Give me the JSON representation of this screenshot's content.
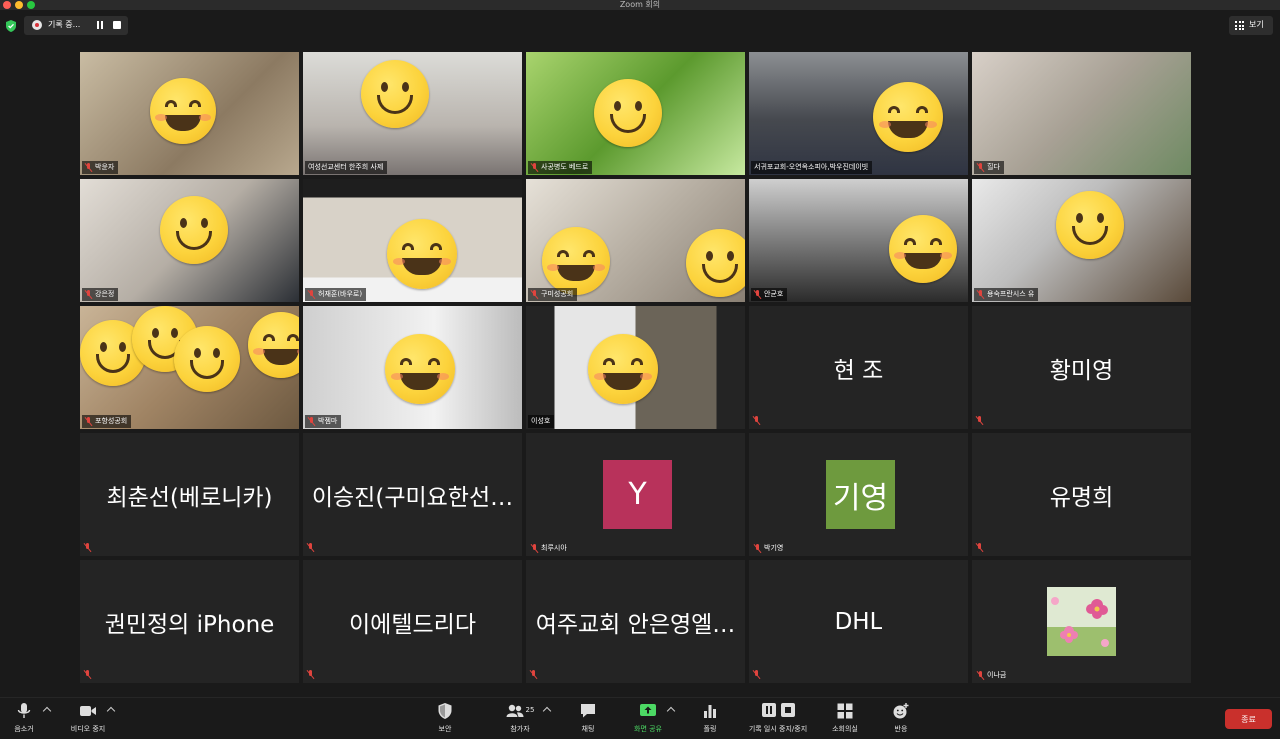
{
  "window": {
    "title": "Zoom 회의"
  },
  "recording": {
    "label": "기록 중..."
  },
  "view": {
    "label": "보기"
  },
  "colors": {
    "accent_active": "#d7e46a",
    "mic_muted": "#e0443e",
    "end_button": "#c9302c",
    "share_green": "#4cd964",
    "avatar_y": "#b8325b",
    "avatar_giyoung": "#6e9a3e"
  },
  "participants": [
    {
      "name": "박윤자",
      "kind": "video",
      "muted": true,
      "bg": "linear-gradient(135deg,#c9bca3,#8c7a62 60%,#b8a88e)"
    },
    {
      "name": "여성선교센터 한주희 사제",
      "kind": "video",
      "muted": false,
      "bg": "linear-gradient(180deg,#dcdcd8,#b9b4ae 60%,#7a7472)"
    },
    {
      "name": "사공병도 베드로",
      "kind": "video",
      "muted": true,
      "bg": "linear-gradient(135deg,#a9d46e,#5c9a2e 50%,#c7e9a0)"
    },
    {
      "name": "서귀포교회-오연옥소피아,박우진데이빗",
      "kind": "video",
      "muted": false,
      "active": true,
      "bg": "linear-gradient(180deg,#8c8f93,#46494f 55%,#2f3442)"
    },
    {
      "name": "힐다",
      "kind": "video",
      "muted": true,
      "bg": "linear-gradient(135deg,#d8d0c8,#a7a094 50%,#6e8a62)"
    },
    {
      "name": "강은정",
      "kind": "video",
      "muted": true,
      "bg": "linear-gradient(135deg,#e2ddd6,#b5aea5 50%,#2b2f35)"
    },
    {
      "name": "허재훈(바우로)",
      "kind": "video",
      "muted": true,
      "bg": "linear-gradient(180deg,#1e1e1e 0 15%,#d8d2c8 15% 80%,#f2f2f2 80%)"
    },
    {
      "name": "구미성공회",
      "kind": "video",
      "muted": true,
      "bg": "linear-gradient(135deg,#e6e1d8,#b8b0a4 50%,#8a8074)"
    },
    {
      "name": "안균호",
      "kind": "video",
      "muted": true,
      "bg": "linear-gradient(180deg,#cfcfcf,#8c8c8c 40%,#2b2b2b)"
    },
    {
      "name": "용숙프란시스 유",
      "kind": "video",
      "muted": true,
      "bg": "linear-gradient(135deg,#e9e9e9,#bdbdbd 40%,#5a4a3a)"
    },
    {
      "name": "포항성공회",
      "kind": "video",
      "muted": true,
      "bg": "linear-gradient(135deg,#c9b497,#a08464 50%,#6d5941)"
    },
    {
      "name": "박젬마",
      "kind": "video",
      "muted": true,
      "bg": "linear-gradient(90deg,#cfcfcf,#f2f2f2 60%,#bcbcbc)"
    },
    {
      "name": "이성호",
      "kind": "video",
      "muted": false,
      "bg": "linear-gradient(90deg,#242424 0 13%,#e6e6e6 13% 50%,#6b6458 50% 87%,#242424 87%)"
    },
    {
      "name": "현 조",
      "kind": "name",
      "muted": true
    },
    {
      "name": "황미영",
      "kind": "name",
      "muted": true
    },
    {
      "name": "최춘선(베로니카)",
      "kind": "name",
      "muted": true
    },
    {
      "name": "이승진(구미요한선…",
      "kind": "name",
      "muted": true
    },
    {
      "name": "최루시아",
      "kind": "letter",
      "muted": true,
      "avatar_text": "Y",
      "avatar_color": "#b8325b"
    },
    {
      "name": "박기영",
      "kind": "letter",
      "muted": true,
      "avatar_text": "기영",
      "avatar_color": "#6e9a3e"
    },
    {
      "name": "유명희",
      "kind": "name",
      "muted": true
    },
    {
      "name": "권민정의 iPhone",
      "kind": "name",
      "muted": true
    },
    {
      "name": "이에텔드리다",
      "kind": "name",
      "muted": true
    },
    {
      "name": "여주교회 안은영엘…",
      "kind": "name",
      "muted": true
    },
    {
      "name": "DHL",
      "kind": "name",
      "muted": true
    },
    {
      "name": "이나금",
      "kind": "photo",
      "muted": true
    }
  ],
  "toolbar": {
    "mute": "음소거",
    "video_stop": "비디오 중지",
    "security": "보안",
    "participants": "참가자",
    "participant_count": "25",
    "chat": "채팅",
    "share_screen": "화면 공유",
    "polls": "폴링",
    "record_pause_stop": "기록 일시 중지/중지",
    "breakout": "소회의실",
    "reactions": "반응",
    "end": "종료"
  }
}
